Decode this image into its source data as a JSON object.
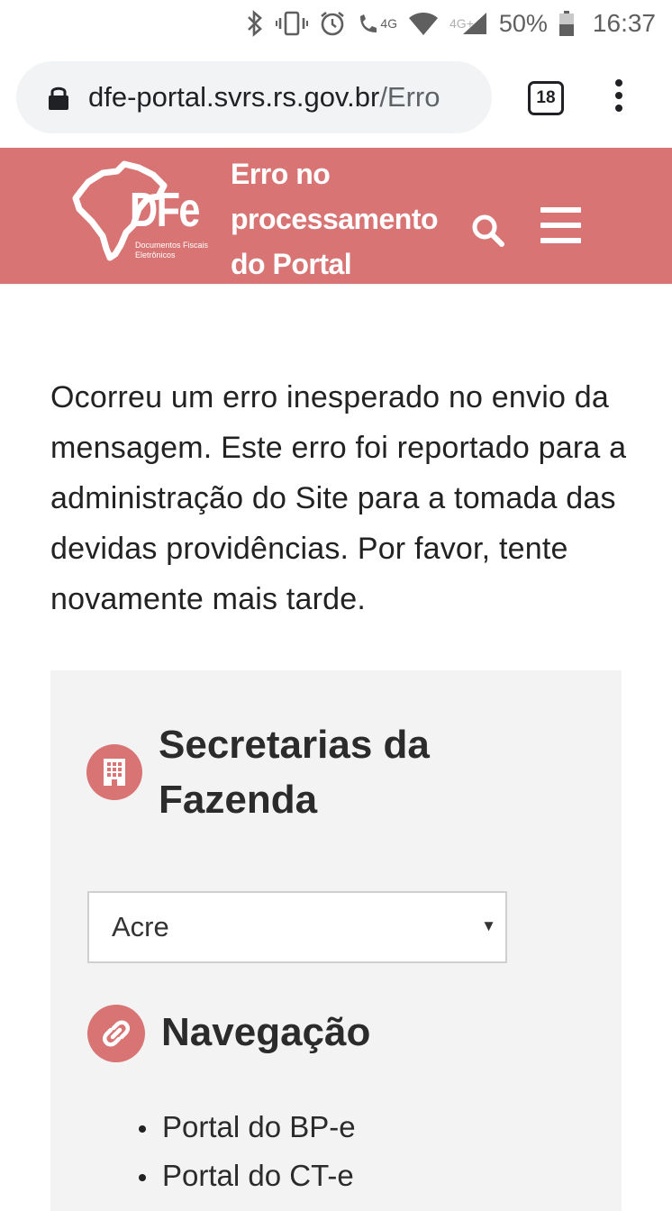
{
  "status_bar": {
    "network_4g": "4G",
    "network_4gplus": "4G+",
    "battery_percent": "50%",
    "time": "16:37",
    "icons": [
      "bluetooth-icon",
      "vibrate-icon",
      "alarm-icon",
      "volte-call-icon",
      "wifi-icon",
      "cell-signal-icon",
      "battery-icon"
    ]
  },
  "browser": {
    "url_host": "dfe-portal.svrs.rs.gov.br",
    "url_path": "/Erro",
    "tab_count": "18"
  },
  "header": {
    "logo_text": "DFe",
    "logo_subtitle_1": "Documentos Fiscais",
    "logo_subtitle_2": "Eletrônicos",
    "title_line1": "Erro no",
    "title_line2": "processamento",
    "title_line3": "do Portal",
    "accent_color": "#d97474"
  },
  "main": {
    "error_message": "Ocorreu um erro inesperado no envio da mensagem. Este erro foi reportado para a administração do Site para a tomada das devidas providências. Por favor, tente novamente mais tarde."
  },
  "sidebar": {
    "secretarias_title": "Secretarias da Fazenda",
    "state_select_value": "Acre",
    "navegacao_title": "Navegação",
    "nav_items": [
      "Portal do BP-e",
      "Portal do CT-e"
    ]
  }
}
